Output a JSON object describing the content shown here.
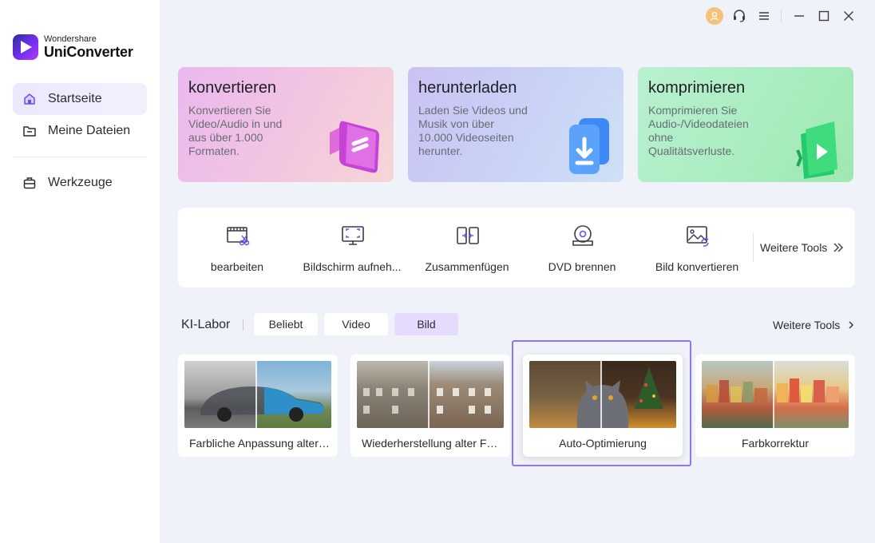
{
  "app": {
    "brand": "Wondershare",
    "product": "UniConverter"
  },
  "colors": {
    "accent": "#7b5cf5",
    "highlight": "#8b78f0",
    "active_pill": "#e4dbfd"
  },
  "sidebar": {
    "items": [
      {
        "label": "Startseite",
        "icon": "home-icon",
        "active": true
      },
      {
        "label": "Meine Dateien",
        "icon": "folder-icon",
        "active": false
      },
      {
        "label": "Werkzeuge",
        "icon": "toolbox-icon",
        "active": false
      }
    ]
  },
  "window": {
    "icons": [
      "avatar-icon",
      "headset-icon",
      "menu-icon",
      "minimize-icon",
      "maximize-icon",
      "close-icon"
    ]
  },
  "cards": [
    {
      "title": "konvertieren",
      "desc": "Konvertieren Sie Video/Audio in und aus über 1.000 Formaten.",
      "icon": "convert-icon"
    },
    {
      "title": "herunterladen",
      "desc": "Laden Sie Videos und Musik von über 10.000 Videoseiten herunter.",
      "icon": "download-icon"
    },
    {
      "title": "komprimieren",
      "desc": "Komprimieren Sie Audio-/Videodateien ohne Qualitätsverluste.",
      "icon": "compress-icon"
    }
  ],
  "tools": {
    "items": [
      {
        "label": "bearbeiten",
        "icon": "edit-video-icon"
      },
      {
        "label": "Bildschirm aufneh...",
        "icon": "screen-record-icon"
      },
      {
        "label": "Zusammenfügen",
        "icon": "merge-icon"
      },
      {
        "label": "DVD brennen",
        "icon": "dvd-icon"
      },
      {
        "label": "Bild konvertieren",
        "icon": "image-convert-icon"
      }
    ],
    "more_label": "Weitere Tools"
  },
  "ki_labor": {
    "title": "KI-Labor",
    "tabs": [
      {
        "label": "Beliebt",
        "active": false
      },
      {
        "label": "Video",
        "active": false
      },
      {
        "label": "Bild",
        "active": true
      }
    ],
    "more_label": "Weitere Tools",
    "cards": [
      {
        "label": "Farbliche Anpassung alter ..."
      },
      {
        "label": "Wiederherstellung alter Fot..."
      },
      {
        "label": "Auto-Optimierung",
        "selected": true
      },
      {
        "label": "Farbkorrektur"
      }
    ]
  }
}
